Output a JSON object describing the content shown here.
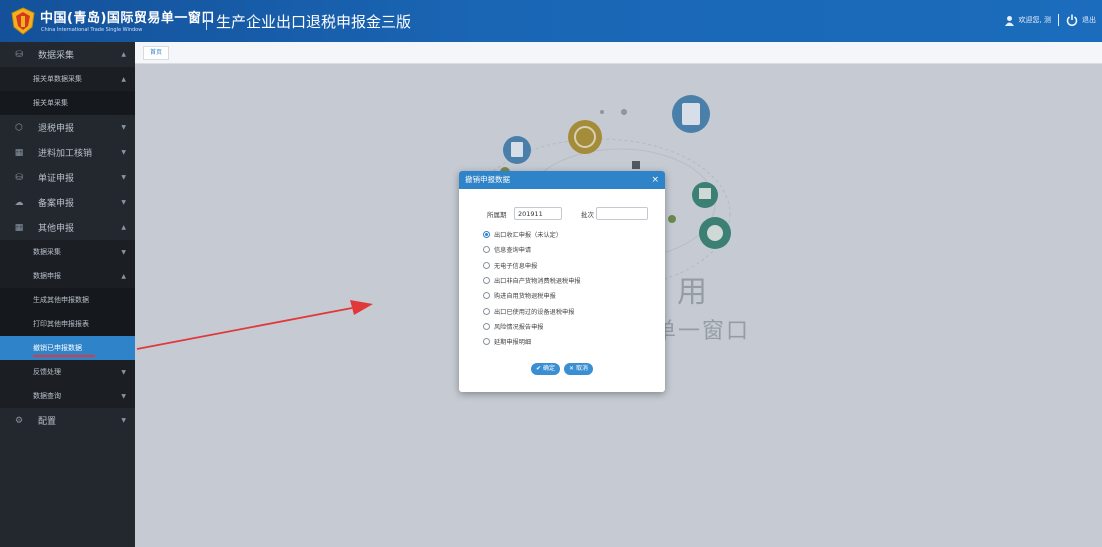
{
  "header": {
    "brand_cn": "中国(青岛)国际贸易单一窗口",
    "brand_en": "China International Trade Single Window",
    "system_title": "生产企业出口退税申报金三版",
    "welcome": "欢迎您, 测",
    "logout": "退出"
  },
  "sidebar": {
    "items": [
      {
        "label": "数据采集",
        "icon": "database-icon",
        "caret": "▲"
      },
      {
        "sub": true,
        "label": "报关单数据采集",
        "caret": "▲"
      },
      {
        "sub": true,
        "label": "报关单采集"
      },
      {
        "label": "退税申报",
        "icon": "cube-icon",
        "caret": "▼"
      },
      {
        "label": "进料加工核销",
        "icon": "calendar-icon",
        "caret": "▼"
      },
      {
        "label": "单证申报",
        "icon": "database-icon",
        "caret": "▼"
      },
      {
        "label": "备案申报",
        "icon": "cloud-icon",
        "caret": "▼"
      },
      {
        "label": "其他申报",
        "icon": "calendar-icon",
        "caret": "▲"
      },
      {
        "sub": true,
        "label": "数据采集",
        "caret": "▼"
      },
      {
        "sub": true,
        "label": "数据申报",
        "caret": "▲"
      },
      {
        "sub": true,
        "label": "生成其他申报数据"
      },
      {
        "sub": true,
        "label": "打印其他申报报表"
      },
      {
        "sub": true,
        "label": "撤销已申报数据",
        "active": true
      },
      {
        "sub": true,
        "label": "反馈处理",
        "caret": "▼"
      },
      {
        "sub": true,
        "label": "数据查询",
        "caret": "▼"
      },
      {
        "label": "配置",
        "icon": "gear-icon",
        "caret": "▼"
      }
    ]
  },
  "tabs": {
    "home": "首页"
  },
  "background": {
    "text1": "用",
    "text2": "单一窗口"
  },
  "modal": {
    "title": "撤销申报数据",
    "close": "×",
    "period_label": "所属期",
    "period_value": "201911",
    "batch_label": "批次",
    "batch_value": "",
    "options": [
      {
        "label": "出口收汇申报（未认定）",
        "checked": true
      },
      {
        "label": "信息查询申请",
        "checked": false
      },
      {
        "label": "无电子信息申报",
        "checked": false
      },
      {
        "label": "出口非自产货物消费税退税申报",
        "checked": false
      },
      {
        "label": "购进自用货物退税申报",
        "checked": false
      },
      {
        "label": "出口已使用过的设备退税申报",
        "checked": false
      },
      {
        "label": "风险情况报告申报",
        "checked": false
      },
      {
        "label": "延期申报明细",
        "checked": false
      }
    ],
    "confirm": "确定",
    "cancel": "取消"
  },
  "colors": {
    "accent": "#2f83c8",
    "header": "#1a66b5",
    "sidebar": "#23282e",
    "annotation": "#e1383a"
  }
}
